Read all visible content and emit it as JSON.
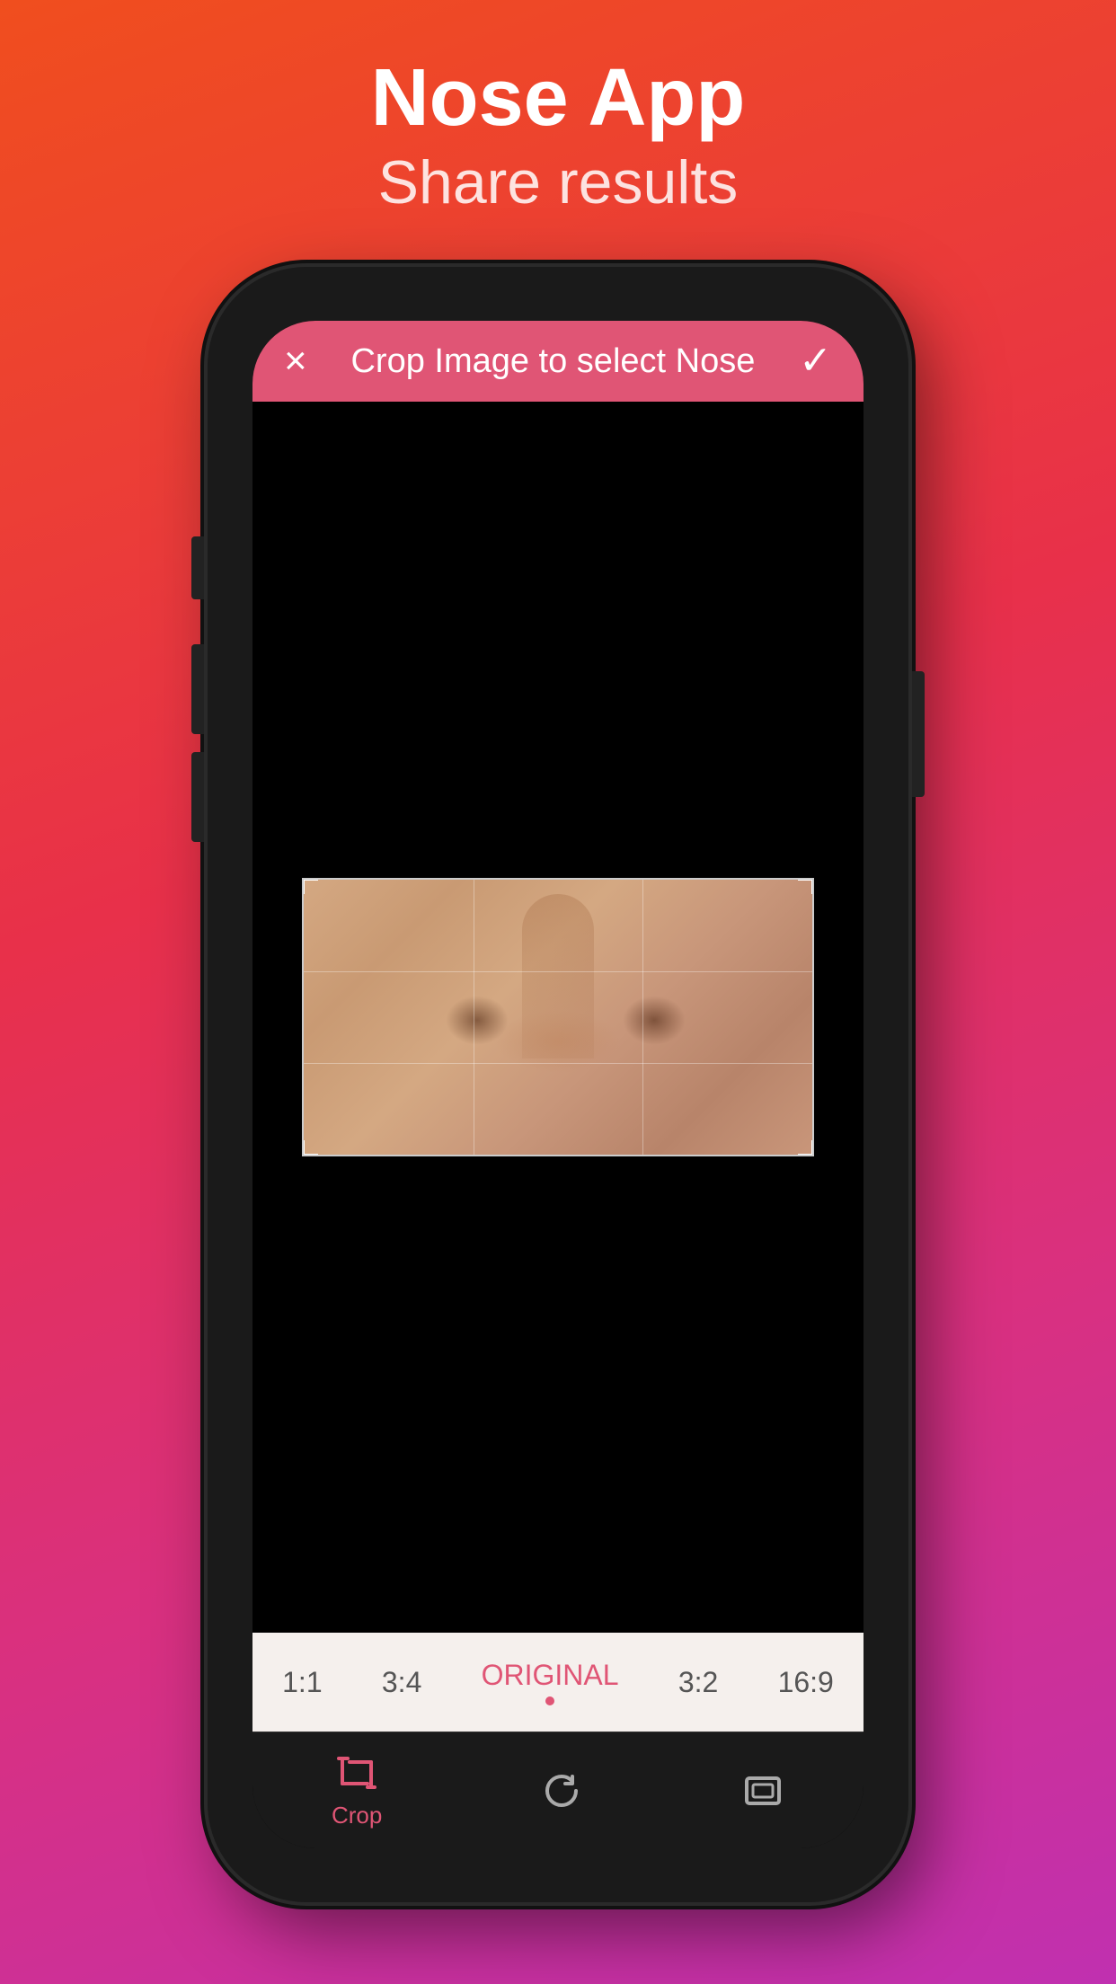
{
  "header": {
    "title": "Nose App",
    "subtitle": "Share results"
  },
  "topBar": {
    "title": "Crop Image to select Nose",
    "cancelLabel": "×",
    "confirmLabel": "✓",
    "backgroundColor": "#e05575"
  },
  "imageArea": {
    "backgroundColor": "#000000"
  },
  "ratioBar": {
    "options": [
      "1:1",
      "3:4",
      "ORIGINAL",
      "3:2",
      "16:9"
    ],
    "activeOption": "ORIGINAL",
    "activeColor": "#e05575"
  },
  "toolbar": {
    "items": [
      {
        "id": "crop",
        "label": "Crop",
        "active": true
      },
      {
        "id": "rotate",
        "label": "",
        "active": false
      },
      {
        "id": "aspect",
        "label": "",
        "active": false
      }
    ]
  }
}
